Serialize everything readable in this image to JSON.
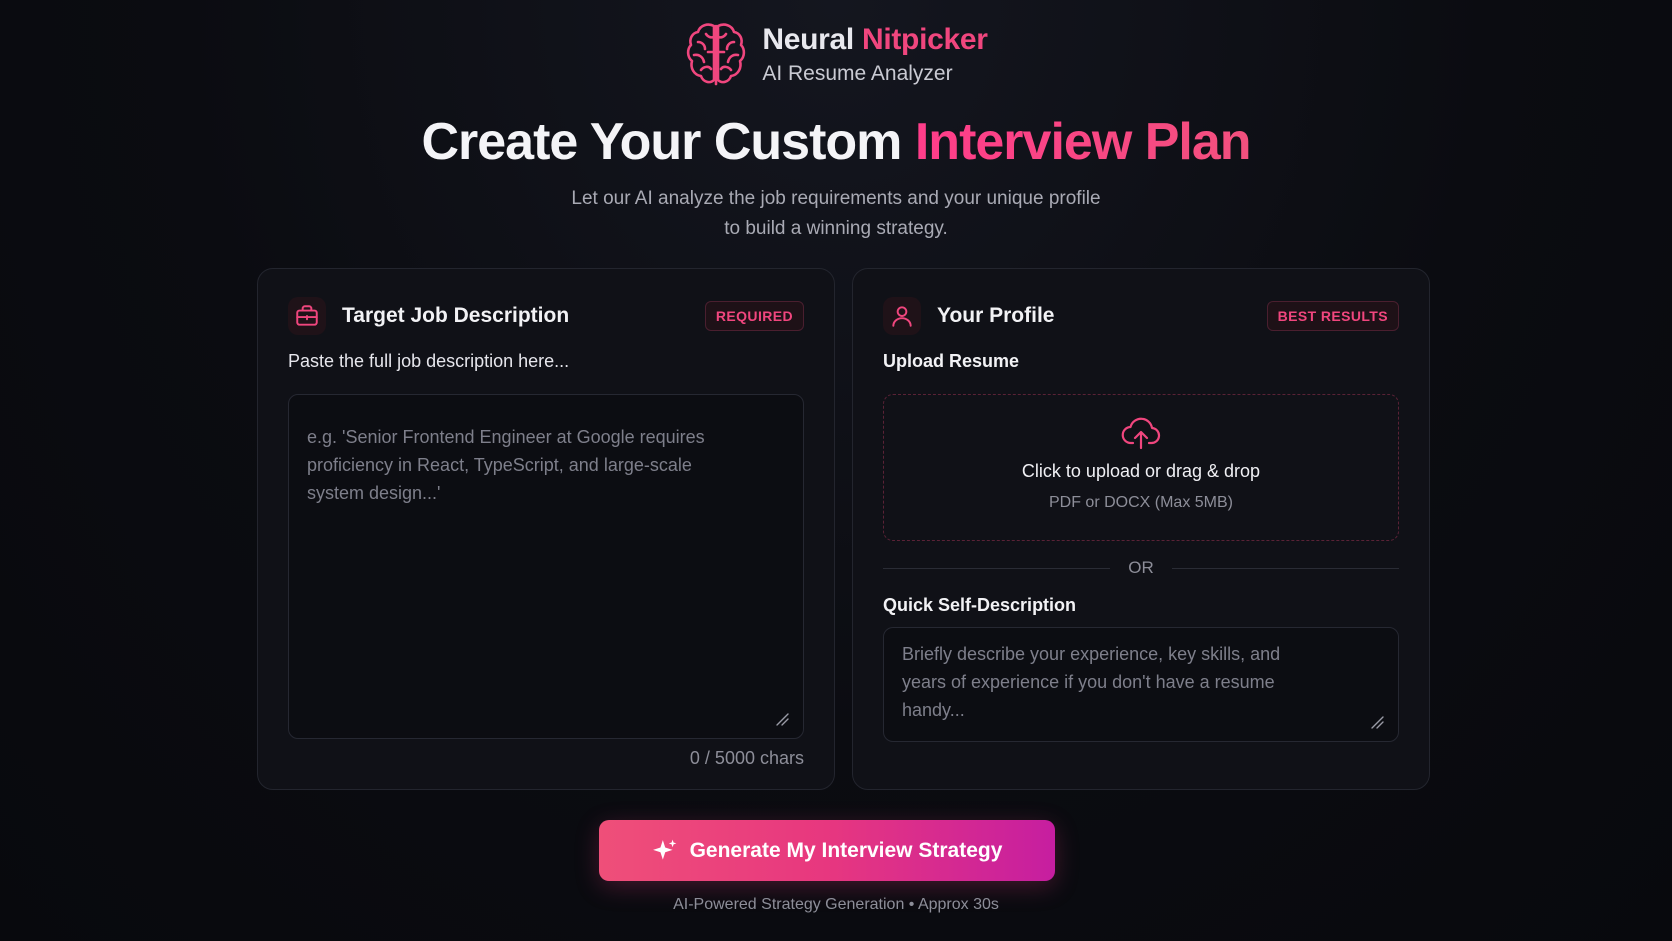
{
  "brand": {
    "name_part1": "Neural",
    "name_part2": "Nitpicker",
    "subtitle": "AI Resume Analyzer",
    "logo_icon": "brain-icon"
  },
  "hero": {
    "title_part1": "Create Your Custom",
    "title_part2": "Interview Plan",
    "subtitle_line1": "Let our AI analyze the job requirements and your unique profile",
    "subtitle_line2": "to build a winning strategy."
  },
  "job_card": {
    "icon": "briefcase-icon",
    "title": "Target Job Description",
    "badge": "REQUIRED",
    "label": "Paste the full job description here...",
    "placeholder_line1": "e.g. 'Senior Frontend Engineer at Google requires",
    "placeholder_line2": "proficiency in React, TypeScript, and large-scale",
    "placeholder_line3": "system design...'",
    "char_count": "0 / 5000 chars"
  },
  "profile_card": {
    "icon": "user-icon",
    "title": "Your Profile",
    "badge": "BEST RESULTS",
    "upload_label": "Upload Resume",
    "upload_icon": "cloud-upload-icon",
    "upload_title": "Click to upload or drag & drop",
    "upload_hint": "PDF or DOCX (Max 5MB)",
    "divider_text": "OR",
    "self_desc_label": "Quick Self-Description",
    "self_desc_placeholder_line1": "Briefly describe your experience, key skills, and",
    "self_desc_placeholder_line2": "years of experience if you don't have a resume",
    "self_desc_placeholder_line3": "handy..."
  },
  "cta": {
    "icon": "sparkle-icon",
    "label": "Generate My Interview Strategy",
    "note": "AI-Powered Strategy Generation • Approx 30s"
  },
  "colors": {
    "accent": "#f0467e",
    "accent_purple": "#c61ea0",
    "background": "#0a0b10",
    "card": "#101117"
  }
}
